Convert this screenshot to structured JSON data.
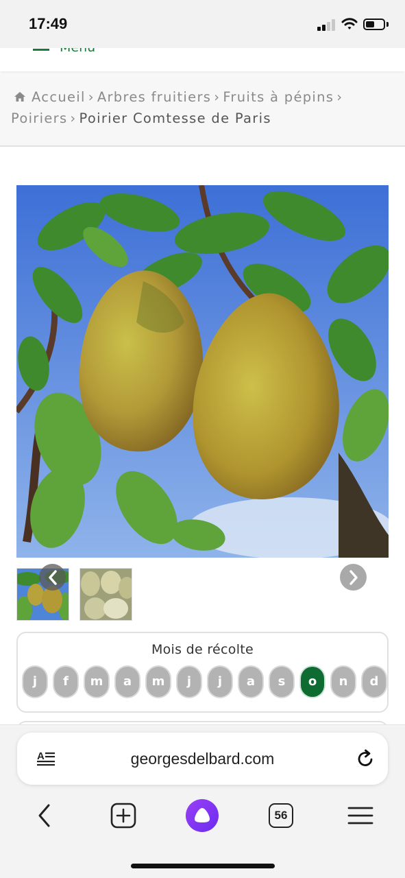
{
  "status_bar": {
    "time": "17:49",
    "signal_icon": "cellular-signal-icon",
    "wifi_icon": "wifi-icon",
    "battery_icon": "battery-icon",
    "battery_level": 0.5
  },
  "header": {
    "menu_label": "Menu",
    "menu_icon": "hamburger-icon",
    "accent_color": "#1a7a3c"
  },
  "breadcrumb": {
    "home_icon": "home-icon",
    "separator": "›",
    "items": [
      "Accueil",
      "Arbres fruitiers",
      "Fruits à pépins",
      "Poiriers"
    ],
    "current": "Poirier Comtesse de Paris"
  },
  "product": {
    "gallery": {
      "prev_icon": "chevron-left-icon",
      "next_icon": "chevron-right-icon",
      "thumbnail_count": 2
    },
    "harvest": {
      "title": "Mois de récolte",
      "months": [
        "j",
        "f",
        "m",
        "a",
        "m",
        "j",
        "j",
        "a",
        "s",
        "o",
        "n",
        "d"
      ],
      "active_index": 9,
      "active_color": "#0e6b32",
      "inactive_color": "#b3b3b3"
    }
  },
  "browser": {
    "url": "georgesdelbard.com",
    "reader_icon": "reader-mode-icon",
    "reload_icon": "reload-icon",
    "toolbar": {
      "back_icon": "back-arrow-icon",
      "new_tab_icon": "plus-square-icon",
      "assistant_icon": "alice-assistant-icon",
      "tabs_count": "56",
      "menu_icon": "hamburger-menu-icon"
    }
  }
}
